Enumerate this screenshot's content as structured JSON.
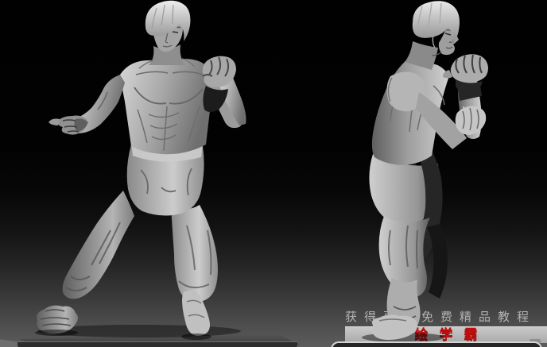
{
  "watermark": {
    "tagline": "获得更多免费精品教程",
    "brand": "绘学霸"
  },
  "figures": {
    "left": "martial-arts-figure-sculpture-front-view",
    "right": "martial-arts-figure-sculpture-side-view"
  },
  "colors": {
    "background_top": "#000000",
    "background_bottom": "#5c5c5c",
    "sculpture_material": "#a8a8a8",
    "tagline_text": "#b3b3b3",
    "brand_text": "#c01010",
    "brand_box_background": "#bdbdbd",
    "platform_top": "#525252",
    "platform_front": "#2d2d2d"
  }
}
